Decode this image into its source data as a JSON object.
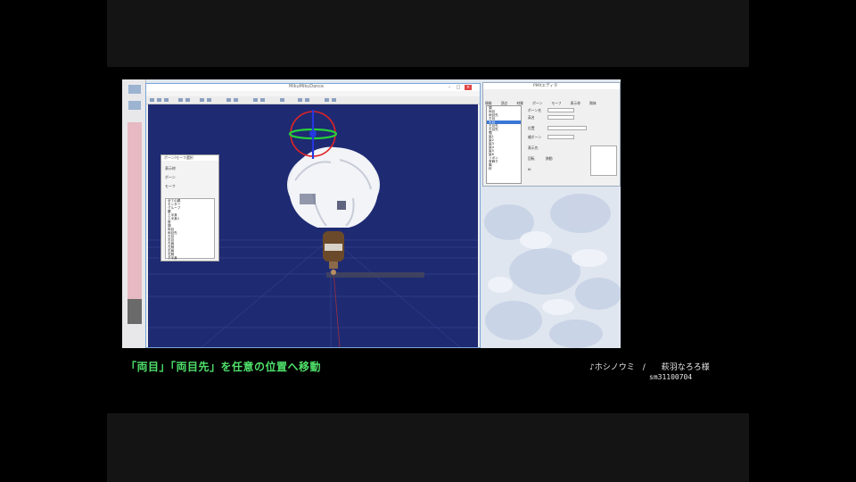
{
  "subtitle": "「両目」「両目先」を任意の位置へ移動",
  "credits": {
    "song": "♪ホシノウミ　/　　萩羽なろろ様",
    "video_id": "sm31100704"
  },
  "mmd_window": {
    "title": "MikuMikuDance",
    "menu": [
      "ﾌｧｲﾙ(F)",
      "編集(E)",
      "表示(V)",
      "背景(B)",
      "物理(P)",
      "ﾍﾙﾌﾟ(H)"
    ],
    "controls": [
      "–",
      "□",
      "×"
    ]
  },
  "bone_panel": {
    "title": "ボーン/モーフ選択",
    "rows": [
      "表示枠",
      "ボーン",
      "モーフ"
    ],
    "items": [
      "全ての親",
      "センター",
      "グルーブ",
      "腰",
      "上半身",
      "上半身2",
      "首",
      "頭",
      "両目",
      "両目先",
      "左目",
      "右目",
      "左肩",
      "左腕",
      "右肩",
      "右腕",
      "下半身"
    ]
  },
  "pmx_window": {
    "title": "PMXエディタ",
    "tabs": [
      "情報",
      "頂点",
      "材質",
      "ボーン",
      "モーフ",
      "表示枠",
      "剛体"
    ],
    "list": [
      "頭",
      "両目",
      "両目先",
      "左目",
      "右目",
      "左目先",
      "右目先",
      "顎",
      "髪1",
      "髪2",
      "髪3",
      "髪4",
      "髪5",
      "髪6",
      "リボン",
      "首飾り",
      "胸",
      "鈴"
    ],
    "selected_index": 4,
    "labels": [
      "ボーン名",
      "英名",
      "位置",
      "親ボーン",
      "表示先",
      "回転",
      "移動",
      "IK"
    ]
  },
  "colors": {
    "subtitle": "#4fe06a",
    "viewport_bg": "#1e2a72",
    "gizmo_red": "#e02525",
    "gizmo_green": "#27d13a",
    "gizmo_blue": "#2538e0"
  },
  "icons": [
    "gizmo-icon",
    "minimize-icon",
    "maximize-icon",
    "close-icon"
  ]
}
